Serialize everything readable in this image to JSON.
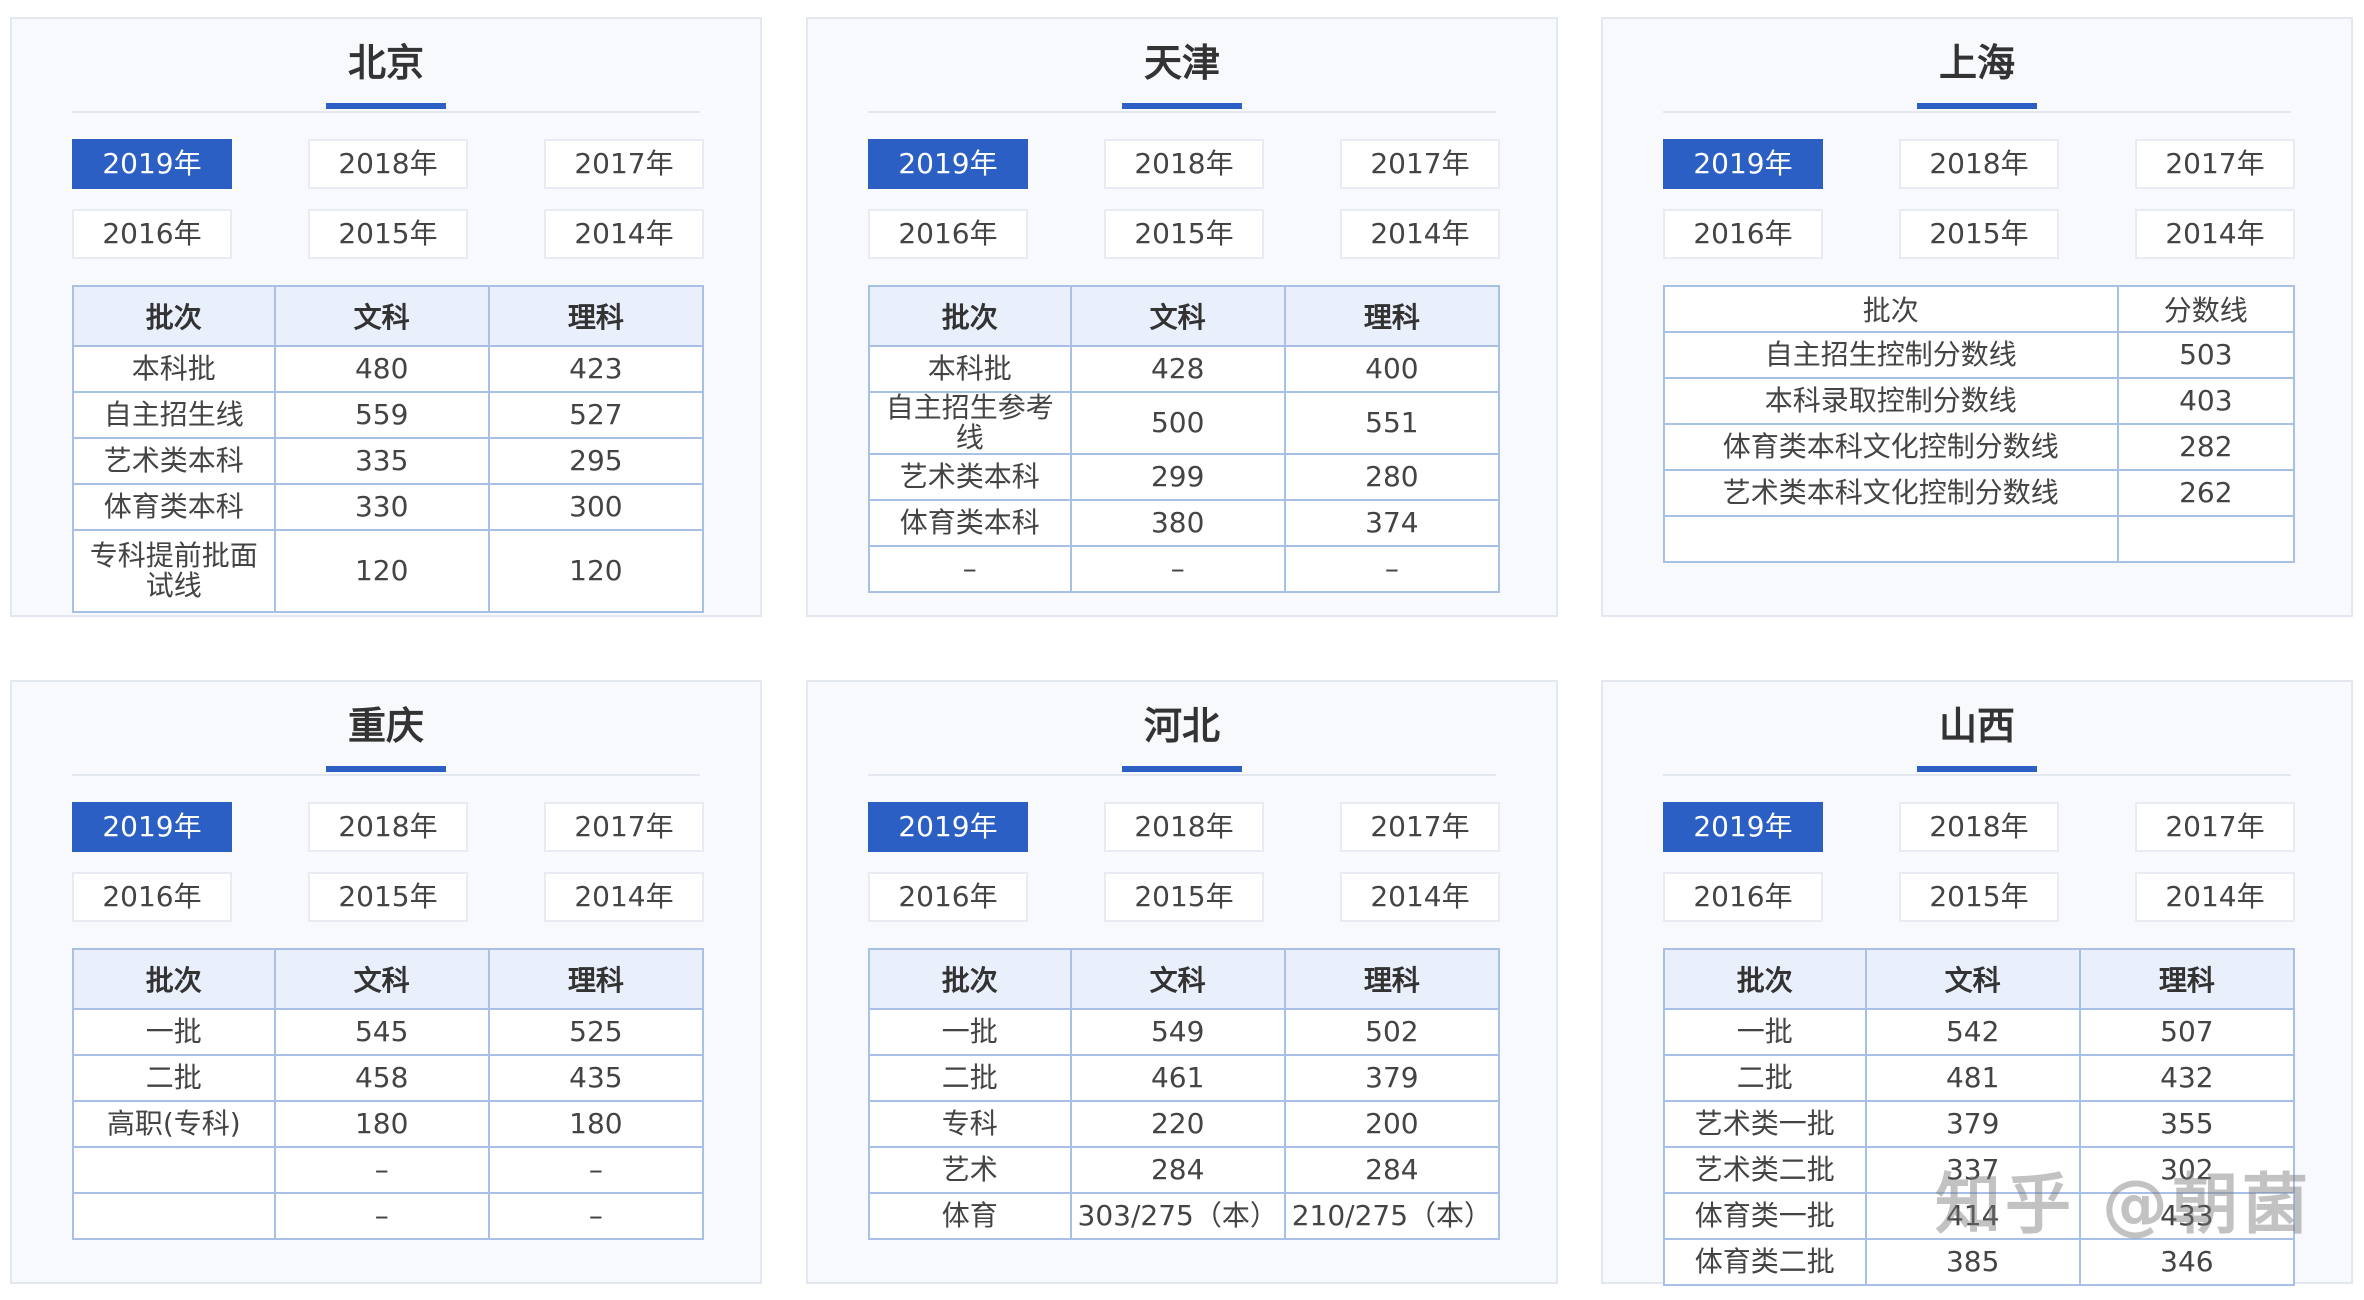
{
  "cards": [
    {
      "title": "北京",
      "years": [
        "2019年",
        "2018年",
        "2017年",
        "2016年",
        "2015年",
        "2014年"
      ],
      "active_year": "2019年",
      "headers": [
        "批次",
        "文科",
        "理科"
      ],
      "rows": [
        [
          "本科批",
          "480",
          "423"
        ],
        [
          "自主招生线",
          "559",
          "527"
        ],
        [
          "艺术类本科",
          "335",
          "295"
        ],
        [
          "体育类本科",
          "330",
          "300"
        ],
        [
          "专科提前批面试线",
          "120",
          "120"
        ]
      ]
    },
    {
      "title": "天津",
      "years": [
        "2019年",
        "2018年",
        "2017年",
        "2016年",
        "2015年",
        "2014年"
      ],
      "active_year": "2019年",
      "headers": [
        "批次",
        "文科",
        "理科"
      ],
      "rows": [
        [
          "本科批",
          "428",
          "400"
        ],
        [
          "自主招生参考线",
          "500",
          "551"
        ],
        [
          "艺术类本科",
          "299",
          "280"
        ],
        [
          "体育类本科",
          "380",
          "374"
        ],
        [
          "–",
          "–",
          "–"
        ]
      ]
    },
    {
      "title": "上海",
      "years": [
        "2019年",
        "2018年",
        "2017年",
        "2016年",
        "2015年",
        "2014年"
      ],
      "active_year": "2019年",
      "headers": [
        "批次",
        "分数线"
      ],
      "rows": [
        [
          "自主招生控制分数线",
          "503"
        ],
        [
          "本科录取控制分数线",
          "403"
        ],
        [
          "体育类本科文化控制分数线",
          "282"
        ],
        [
          "艺术类本科文化控制分数线",
          "262"
        ],
        [
          "",
          ""
        ]
      ]
    },
    {
      "title": "重庆",
      "years": [
        "2019年",
        "2018年",
        "2017年",
        "2016年",
        "2015年",
        "2014年"
      ],
      "active_year": "2019年",
      "headers": [
        "批次",
        "文科",
        "理科"
      ],
      "rows": [
        [
          "一批",
          "545",
          "525"
        ],
        [
          "二批",
          "458",
          "435"
        ],
        [
          "高职(专科)",
          "180",
          "180"
        ],
        [
          "",
          "–",
          "–"
        ],
        [
          "",
          "–",
          "–"
        ]
      ]
    },
    {
      "title": "河北",
      "years": [
        "2019年",
        "2018年",
        "2017年",
        "2016年",
        "2015年",
        "2014年"
      ],
      "active_year": "2019年",
      "headers": [
        "批次",
        "文科",
        "理科"
      ],
      "rows": [
        [
          "一批",
          "549",
          "502"
        ],
        [
          "二批",
          "461",
          "379"
        ],
        [
          "专科",
          "220",
          "200"
        ],
        [
          "艺术",
          "284",
          "284"
        ],
        [
          "体育",
          "303/275（本）",
          "210/275（本）"
        ]
      ]
    },
    {
      "title": "山西",
      "years": [
        "2019年",
        "2018年",
        "2017年",
        "2016年",
        "2015年",
        "2014年"
      ],
      "active_year": "2019年",
      "headers": [
        "批次",
        "文科",
        "理科"
      ],
      "rows": [
        [
          "一批",
          "542",
          "507"
        ],
        [
          "二批",
          "481",
          "432"
        ],
        [
          "艺术类一批",
          "379",
          "355"
        ],
        [
          "艺术类二批",
          "337",
          "302"
        ],
        [
          "体育类一批",
          "414",
          "433"
        ],
        [
          "体育类二批",
          "385",
          "346"
        ]
      ]
    }
  ],
  "watermark": "知乎 @朝菌"
}
